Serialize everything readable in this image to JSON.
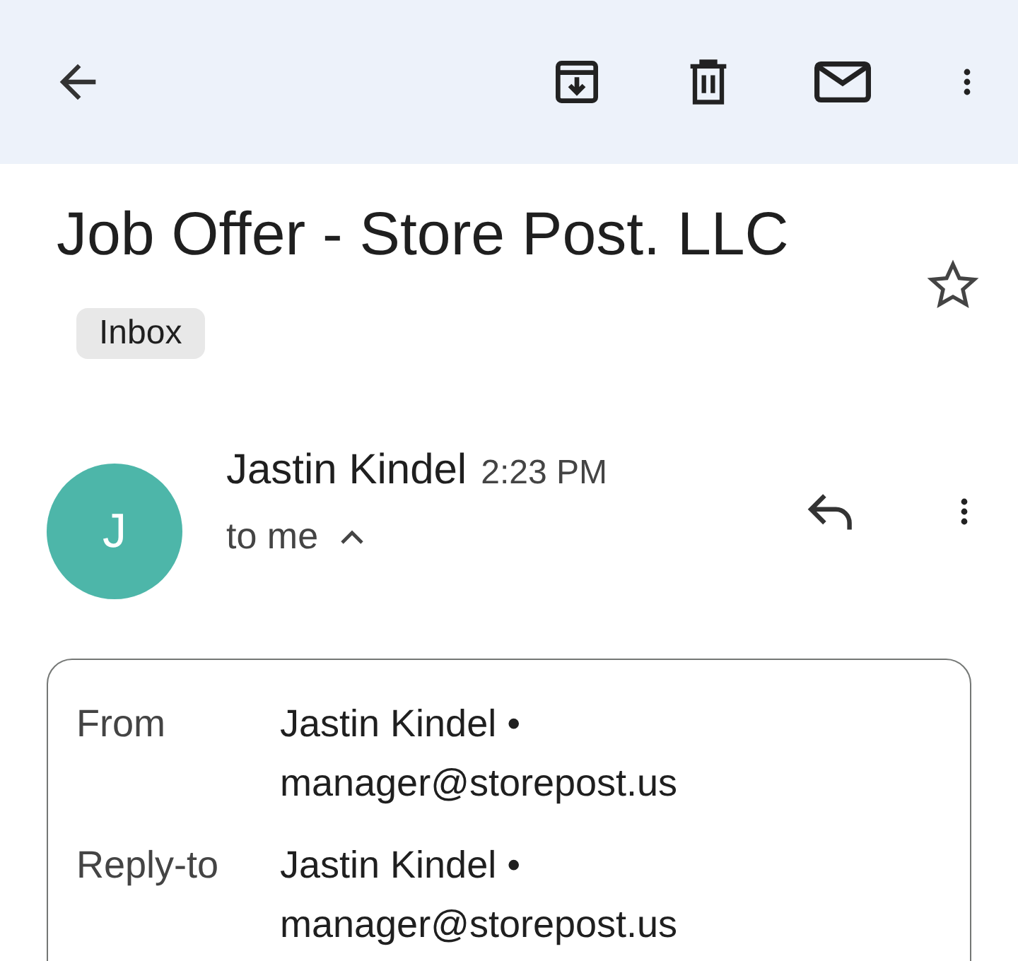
{
  "subject": "Job Offer - Store Post. LLC",
  "label": "Inbox",
  "starred": false,
  "message": {
    "avatar_letter": "J",
    "sender": "Jastin Kindel",
    "time": "2:23 PM",
    "recipient": "to me",
    "expanded": true
  },
  "details": [
    {
      "label": "From",
      "name": "Jastin Kindel •",
      "email": "manager@storepost.us"
    },
    {
      "label": "Reply-to",
      "name": "Jastin Kindel •",
      "email": "manager@storepost.us"
    }
  ]
}
